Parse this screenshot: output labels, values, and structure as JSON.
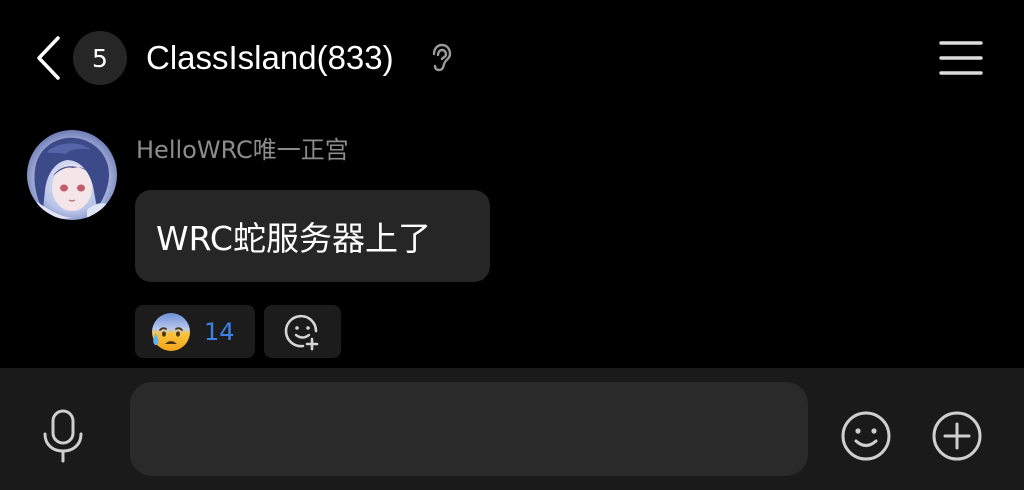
{
  "header": {
    "back_icon": "chevron-left-icon",
    "unread_count": "5",
    "title": "ClassIsland(833)",
    "ear_icon": "ear-icon",
    "menu_icon": "hamburger-menu-icon"
  },
  "message": {
    "sender": "HelloWRC唯一正宫",
    "text": "WRC蛇服务器上了",
    "avatar_icon": "anime-avatar",
    "reaction": {
      "emoji": "anxious-face-with-sweat-emoji",
      "count": "14"
    },
    "add_reaction_icon": "add-emoji-icon"
  },
  "input_bar": {
    "mic_icon": "microphone-icon",
    "placeholder": "",
    "emoji_icon": "smiley-icon",
    "plus_icon": "plus-circle-icon"
  },
  "colors": {
    "background": "#000000",
    "bubble": "#262626",
    "input_bar": "#1a1a1a",
    "reaction_count": "#3d82e6",
    "sender_name": "#8c8c8c"
  }
}
